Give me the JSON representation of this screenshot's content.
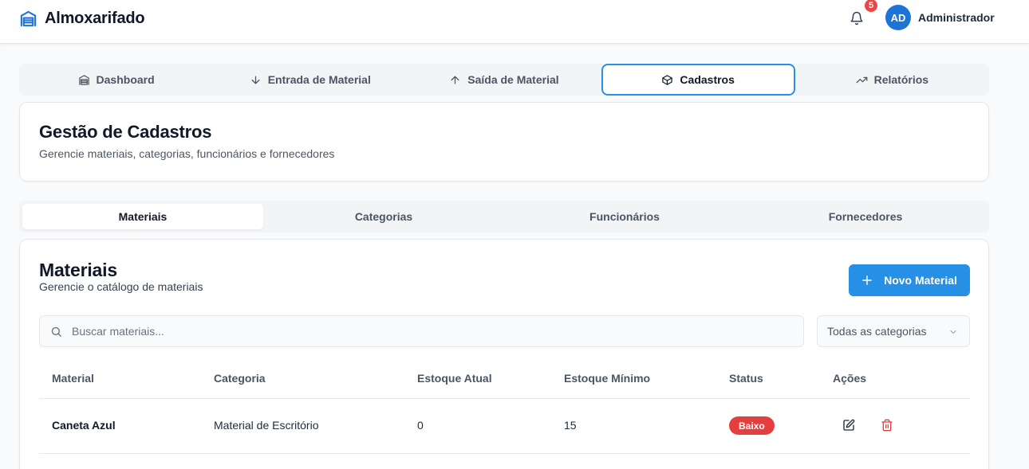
{
  "app": {
    "title": "Almoxarifado",
    "accent_color": "#2590e6",
    "notifications_count": "5",
    "user_initials": "AD",
    "user_name": "Administrador"
  },
  "main_tabs": [
    {
      "label": "Dashboard",
      "icon": "dashboard-icon"
    },
    {
      "label": "Entrada de Material",
      "icon": "arrow-down-icon"
    },
    {
      "label": "Saída de Material",
      "icon": "arrow-up-icon"
    },
    {
      "label": "Cadastros",
      "icon": "box-icon",
      "active": true
    },
    {
      "label": "Relatórios",
      "icon": "trending-up-icon"
    }
  ],
  "page_header": {
    "title": "Gestão de Cadastros",
    "subtitle": "Gerencie materiais, categorias, funcionários e fornecedores"
  },
  "sub_tabs": [
    {
      "label": "Materiais",
      "active": true
    },
    {
      "label": "Categorias"
    },
    {
      "label": "Funcionários"
    },
    {
      "label": "Fornecedores"
    }
  ],
  "materials": {
    "title": "Materiais",
    "subtitle": "Gerencie o catálogo de materiais",
    "new_button": "Novo Material",
    "search_placeholder": "Buscar materiais...",
    "category_filter": "Todas as categorias",
    "columns": [
      "Material",
      "Categoria",
      "Estoque Atual",
      "Estoque Mínimo",
      "Status",
      "Ações"
    ],
    "rows": [
      {
        "material": "Caneta Azul",
        "categoria": "Material de Escritório",
        "estoque_atual": "0",
        "estoque_minimo": "15",
        "status": "Baixo",
        "status_color": "#e53e3e"
      }
    ]
  }
}
